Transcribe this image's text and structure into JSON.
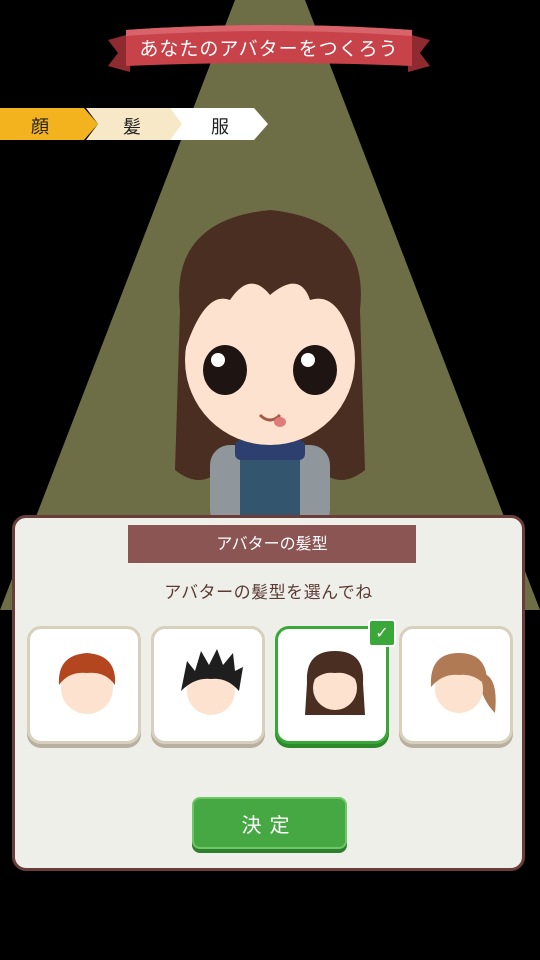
{
  "title": "あなたのアバターをつくろう",
  "steps": [
    {
      "label": "顔",
      "state": "done"
    },
    {
      "label": "髪",
      "state": "current"
    },
    {
      "label": "服",
      "state": "todo"
    }
  ],
  "panel": {
    "header": "アバターの髪型",
    "instruction": "アバターの髪型を選んでね",
    "options": [
      {
        "name": "short-brown",
        "selected": false
      },
      {
        "name": "spiky-black",
        "selected": false
      },
      {
        "name": "bob-dark-brown",
        "selected": true
      },
      {
        "name": "ponytail-light-brown",
        "selected": false
      }
    ],
    "confirm_label": "決定"
  },
  "colors": {
    "ribbon": "#c8424a",
    "step_done": "#f2b31f",
    "step_current": "#f7e9c8",
    "step_todo": "#ffffff",
    "spotlight": "#6e6e46",
    "accent_green": "#46a843",
    "panel_border": "#6a3c3a",
    "panel_header": "#8a5552"
  },
  "icons": {
    "check": "checkmark-icon"
  }
}
